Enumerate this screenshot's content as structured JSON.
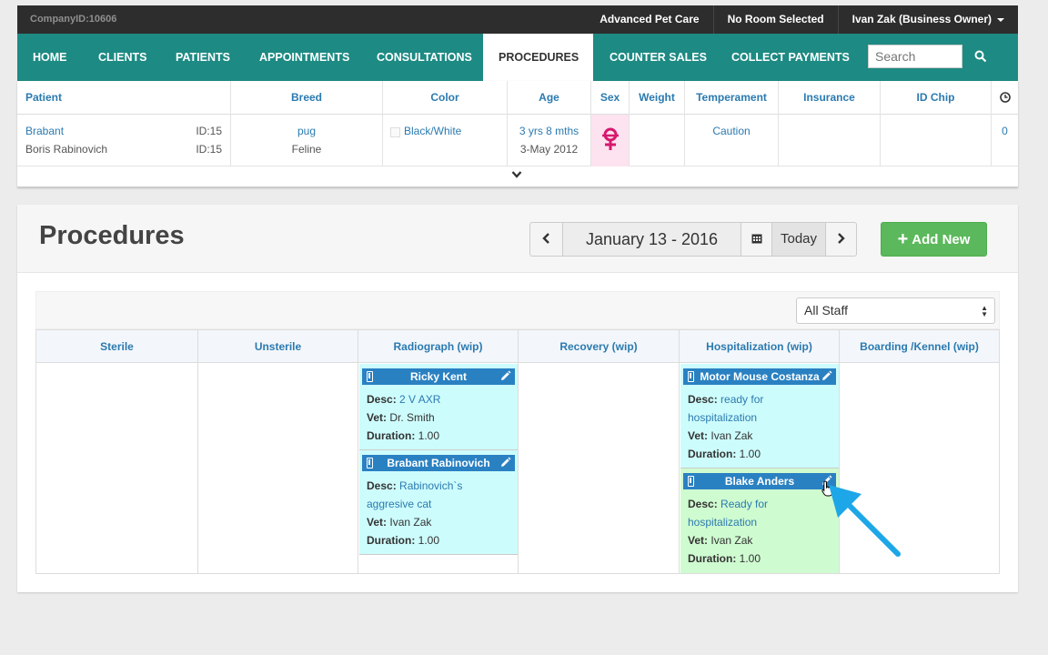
{
  "topbar": {
    "company_id": "CompanyID:10606",
    "clinic": "Advanced Pet Care",
    "room": "No Room Selected",
    "user": "Ivan Zak (Business Owner)"
  },
  "nav": {
    "items": [
      "HOME",
      "CLIENTS",
      "PATIENTS",
      "APPOINTMENTS",
      "CONSULTATIONS",
      "PROCEDURES",
      "COUNTER SALES",
      "COLLECT PAYMENTS"
    ],
    "active": "PROCEDURES",
    "search_placeholder": "Search"
  },
  "patient": {
    "headers": [
      "Patient",
      "Breed",
      "Color",
      "Age",
      "Sex",
      "Weight",
      "Temperament",
      "Insurance",
      "ID Chip"
    ],
    "name": "Brabant",
    "name_id": "ID:15",
    "owner": "Boris Rabinovich",
    "owner_id": "ID:15",
    "breed": "pug",
    "species": "Feline",
    "color": "Black/White",
    "age": "3 yrs 8 mths",
    "dob": "3-May 2012",
    "sex_icon": "female-spayed-icon",
    "weight": "",
    "temperament": "Caution",
    "insurance": "",
    "id_chip": "",
    "clock_count": "0"
  },
  "procedures": {
    "title": "Procedures",
    "date": "January 13 - 2016",
    "today_label": "Today",
    "add_new_label": "Add New",
    "staff_filter": "All Staff",
    "columns": [
      "Sterile",
      "Unsterile",
      "Radiograph (wip)",
      "Recovery (wip)",
      "Hospitalization (wip)",
      "Boarding /Kennel (wip)"
    ],
    "field_labels": {
      "desc": "Desc:",
      "vet": "Vet:",
      "duration": "Duration:"
    },
    "cards": [
      {
        "name": "Ricky Kent",
        "desc": "2 V AXR",
        "vet": "Dr. Smith",
        "duration": "1.00"
      },
      {
        "name": "Brabant Rabinovich",
        "desc": "Rabinovich`s aggresive cat",
        "vet": "Ivan Zak",
        "duration": "1.00"
      },
      {
        "name": "Motor Mouse Costanza",
        "desc": "ready for hospitalization",
        "vet": "Ivan Zak",
        "duration": "1.00"
      },
      {
        "name": "Blake Anders",
        "desc": "Ready for hospitalization",
        "vet": "Ivan Zak",
        "duration": "1.00"
      }
    ]
  },
  "colors": {
    "nav_teal": "#1d8a83",
    "card_header_blue": "#2a81c2",
    "card_cyan": "#cdfcfc",
    "card_green": "#cffbd0",
    "add_button_green": "#5cb85c",
    "annotation_arrow": "#1ea7e8"
  }
}
